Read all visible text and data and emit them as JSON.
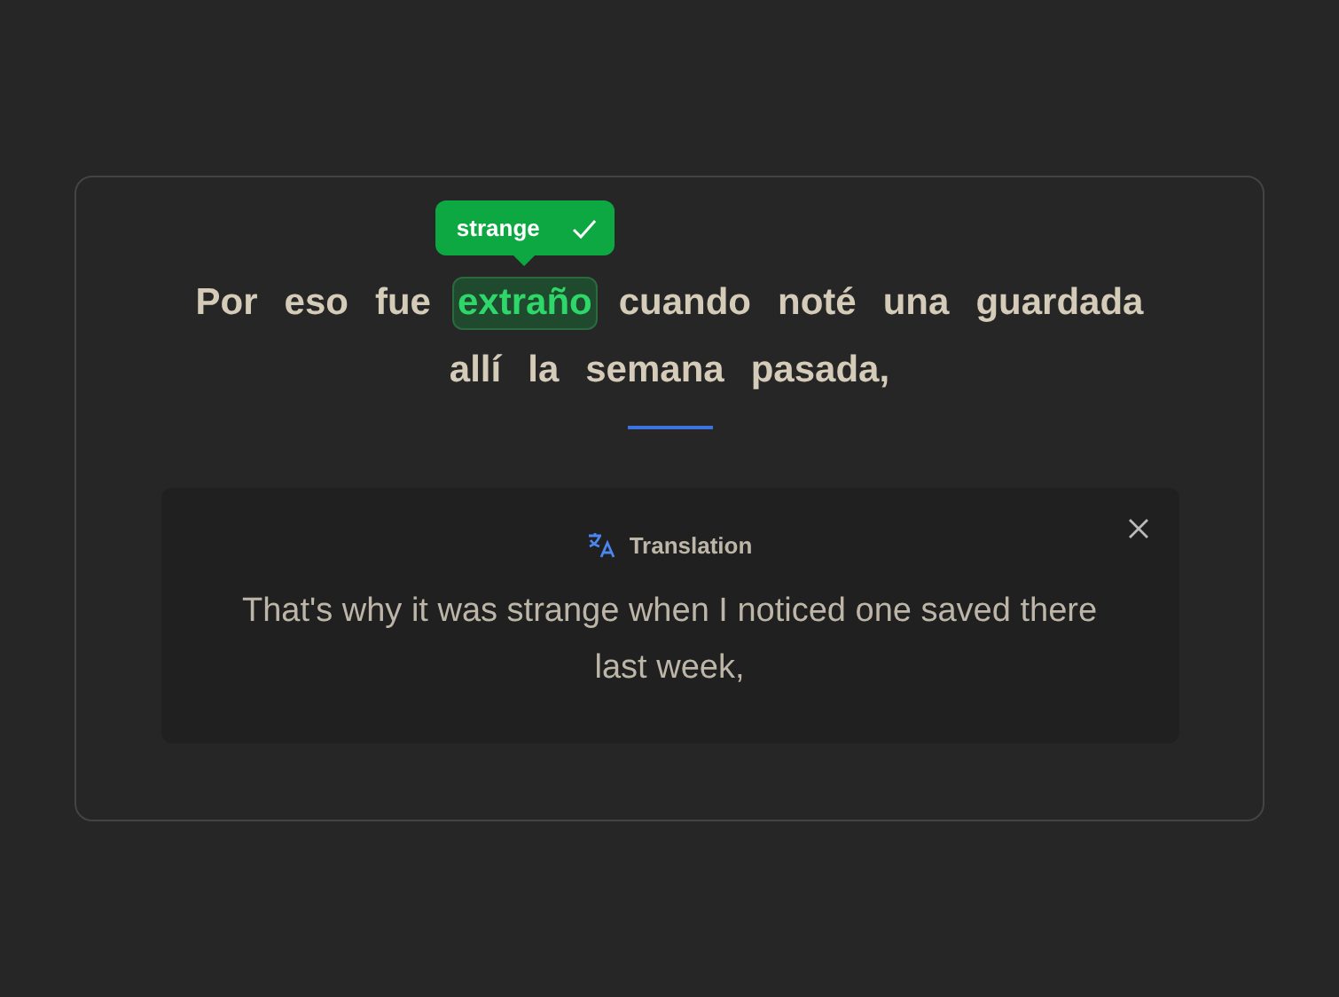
{
  "sentence": {
    "lines": [
      [
        {
          "text": "Por",
          "highlighted": false
        },
        {
          "text": "eso",
          "highlighted": false
        },
        {
          "text": "fue",
          "highlighted": false
        },
        {
          "text": "extraño",
          "highlighted": true,
          "tooltip": "strange"
        },
        {
          "text": "cuando",
          "highlighted": false
        },
        {
          "text": "noté",
          "highlighted": false
        },
        {
          "text": "una",
          "highlighted": false
        },
        {
          "text": "guardada",
          "highlighted": false
        }
      ],
      [
        {
          "text": "allí",
          "highlighted": false
        },
        {
          "text": "la",
          "highlighted": false
        },
        {
          "text": "semana",
          "highlighted": false
        },
        {
          "text": "pasada,",
          "highlighted": false
        }
      ]
    ]
  },
  "translation": {
    "title": "Translation",
    "text": "That's why it was strange when I noticed one saved there last week,"
  }
}
